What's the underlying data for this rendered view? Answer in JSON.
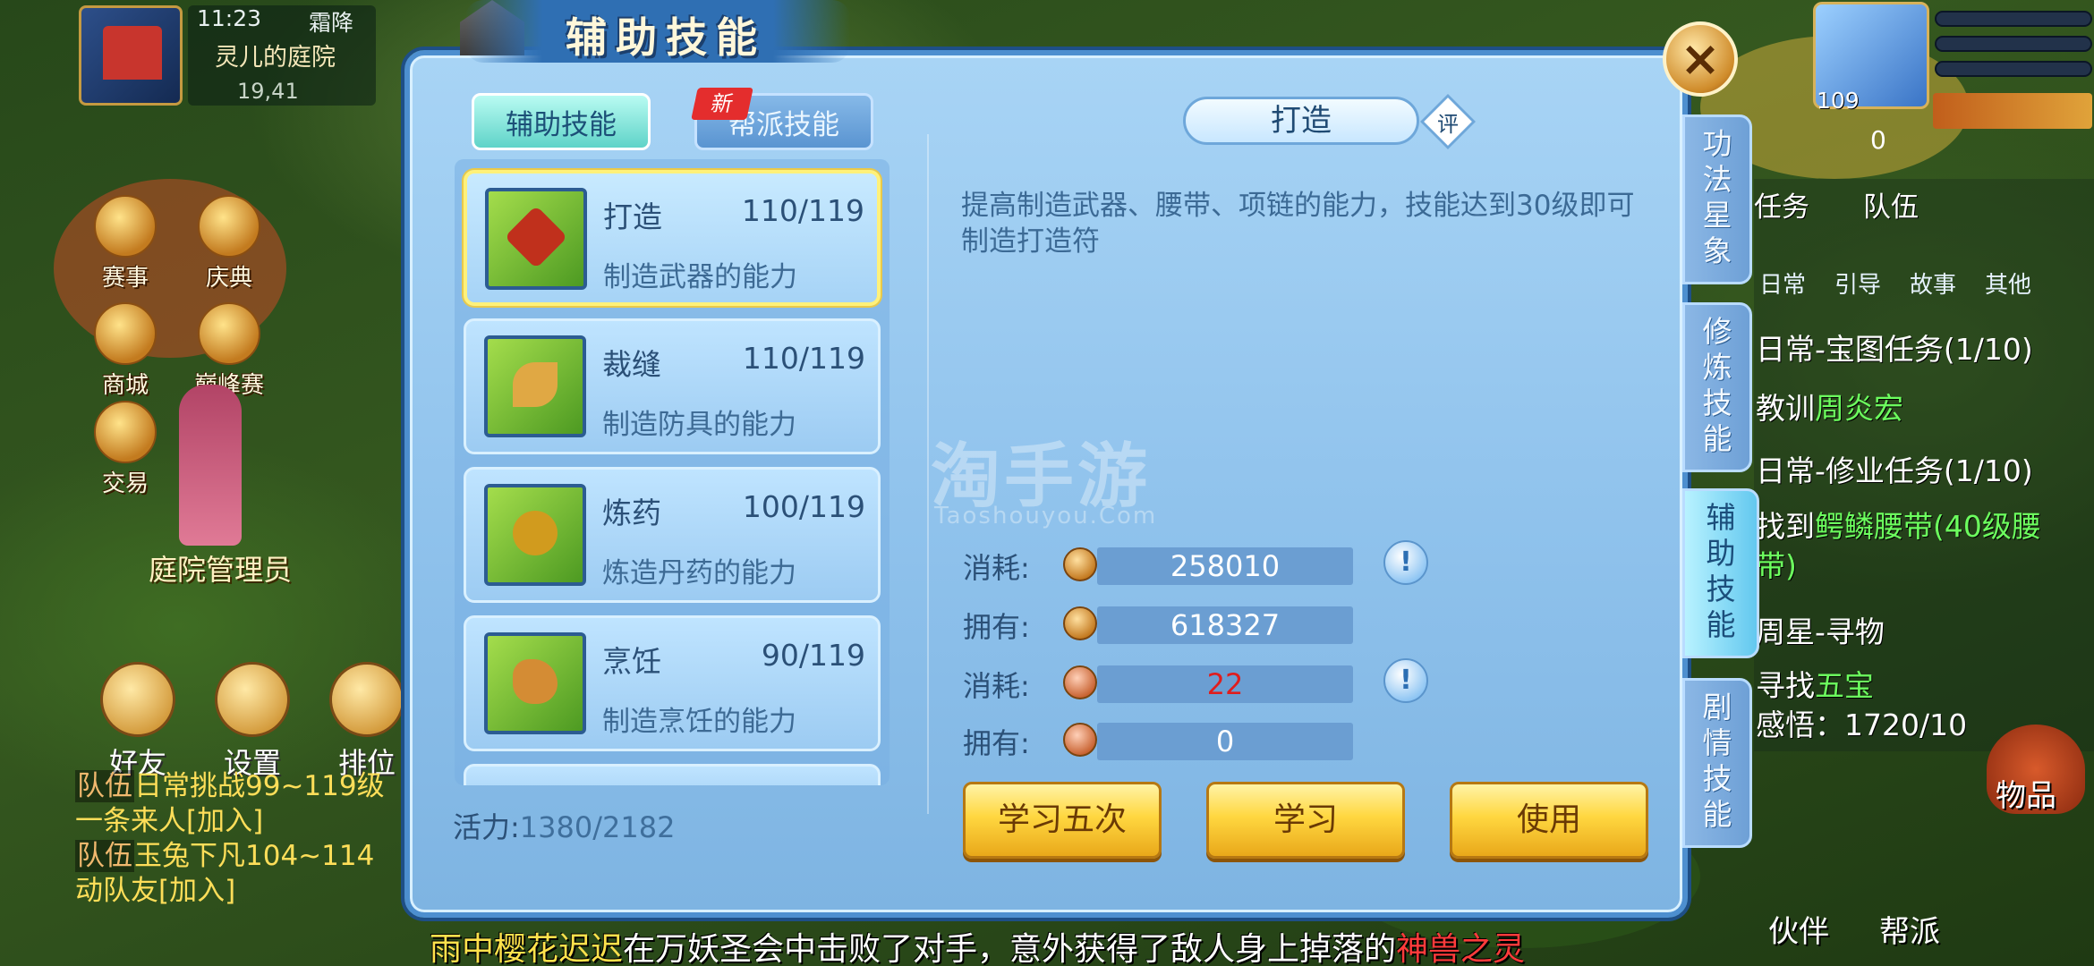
{
  "game_hud": {
    "time": "11:23",
    "weather": "霜降",
    "location": "灵儿的庭院",
    "coords": "19,41",
    "left_buttons": [
      "赛事",
      "庆典",
      "商城",
      "巅峰赛",
      "交易"
    ],
    "npc_name": "庭院管理员",
    "bottom_buttons": [
      "好友",
      "设置",
      "排位"
    ],
    "player_level": "109",
    "zero_count": "0"
  },
  "chat": [
    {
      "tag": "队伍",
      "text": "日常挑战99~119级",
      "sub": "一条来人[加入]"
    },
    {
      "tag": "队伍",
      "text": "玉兔下凡104~114",
      "sub": "动队友[加入]"
    }
  ],
  "task_panel": {
    "top_tabs": [
      "任务",
      "队伍"
    ],
    "categories": [
      "日常",
      "引导",
      "故事",
      "其他"
    ],
    "lines": [
      {
        "pre": "日常-宝图任务(1/10)",
        "hl": ""
      },
      {
        "pre": "教训",
        "hl": "周炎宏"
      },
      {
        "pre": "日常-修业任务(1/10)",
        "hl": ""
      },
      {
        "pre": "找到",
        "hl": "鳄鳞腰带(40级腰"
      },
      {
        "pre": "带)",
        "hl": ""
      },
      {
        "pre": "周星-寻物",
        "hl": ""
      },
      {
        "pre": "寻找",
        "hl": "五宝"
      },
      {
        "pre": "感悟：1720/10",
        "hl": ""
      }
    ],
    "bag_label": "物品",
    "bottom_labels": [
      "伙伴",
      "帮派"
    ]
  },
  "dialog": {
    "title": "辅助技能",
    "close_label": "×",
    "tabs": [
      {
        "label": "辅助技能",
        "active": true
      },
      {
        "label": "帮派技能",
        "active": false,
        "badge": "新"
      }
    ],
    "skills": [
      {
        "name": "打造",
        "level": "110/119",
        "desc": "制造武器的能力",
        "icon": "hammer-icon"
      },
      {
        "name": "裁缝",
        "level": "110/119",
        "desc": "制造防具的能力",
        "icon": "leaf-icon"
      },
      {
        "name": "炼药",
        "level": "100/119",
        "desc": "炼造丹药的能力",
        "icon": "pot-icon"
      },
      {
        "name": "烹饪",
        "level": "90/119",
        "desc": "制造烹饪的能力",
        "icon": "drumstick-icon"
      }
    ],
    "vitality_label": "活力:",
    "vitality_value": "1380/2182",
    "selected_skill": {
      "title": "打造",
      "review_badge": "评",
      "description": "提高制造武器、腰带、项链的能力，技能达到30级即可制造打造符"
    },
    "costs": [
      {
        "label": "消耗:",
        "value": "258010",
        "coin": "silver-coin-icon",
        "info": true,
        "red": false
      },
      {
        "label": "拥有:",
        "value": "618327",
        "coin": "silver-coin-icon",
        "info": false,
        "red": false
      },
      {
        "label": "消耗:",
        "value": "22",
        "coin": "contribution-coin-icon",
        "info": true,
        "red": true
      },
      {
        "label": "拥有:",
        "value": "0",
        "coin": "contribution-coin-icon",
        "info": false,
        "red": false
      }
    ],
    "info_label": "!",
    "buttons": {
      "learn5": "学习五次",
      "learn": "学习",
      "use": "使用"
    },
    "side_tabs": [
      {
        "label": "功\n法\n星\n象",
        "active": false
      },
      {
        "label": "修\n炼\n技\n能",
        "active": false
      },
      {
        "label": "辅\n助\n技\n能",
        "active": true
      },
      {
        "label": "剧\n情\n技\n能",
        "active": false
      }
    ]
  },
  "watermark": {
    "main": "淘手游",
    "sub": "Taoshouyou.Com"
  },
  "marquee": {
    "name": "雨中樱花迟迟",
    "middle": "在万妖圣会中击败了对手，意外获得了敌人身上掉落的",
    "item": "神兽之灵"
  }
}
